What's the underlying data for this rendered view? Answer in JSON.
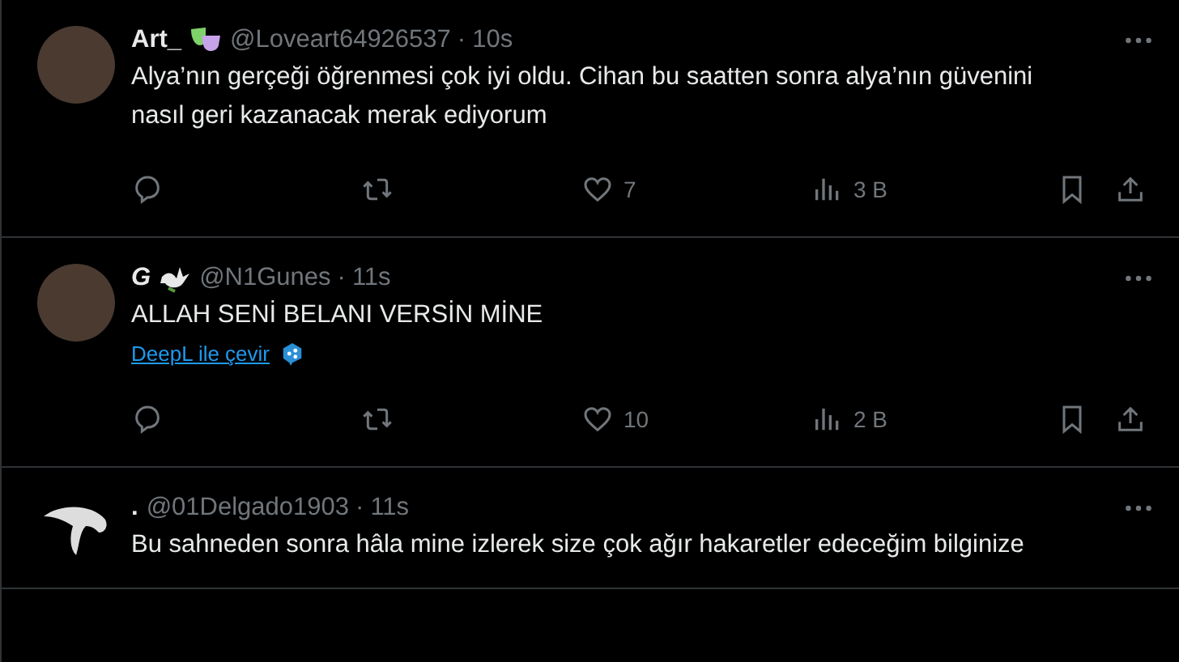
{
  "tweets": [
    {
      "name": "Art_",
      "badge": {
        "kind": "masks"
      },
      "avatar": {
        "kind": "photo"
      },
      "handle": "@Loveart64926537",
      "separator": "·",
      "time": "10s",
      "text": "Alya’nın gerçeği öğrenmesi çok iyi oldu. Cihan bu saatten sonra alya’nın güvenini nasıl geri kazanacak merak ediyorum",
      "likes": "7",
      "views": "3 B"
    },
    {
      "name": "G",
      "badge": {
        "kind": "dove"
      },
      "avatar": {
        "kind": "photo"
      },
      "handle": "@N1Gunes",
      "separator": "·",
      "time": "11s",
      "text": "ALLAH SENİ BELANI VERSİN MİNE",
      "translate": "DeepL ile çevir",
      "likes": "10",
      "views": "2 B"
    },
    {
      "name": ".",
      "avatar": {
        "kind": "bird"
      },
      "handle": "@01Delgado1903",
      "separator": "·",
      "time": "11s",
      "text": "Bu sahneden sonra hâla mine izlerek size çok ağır hakaretler edeceğim bilginize"
    }
  ]
}
